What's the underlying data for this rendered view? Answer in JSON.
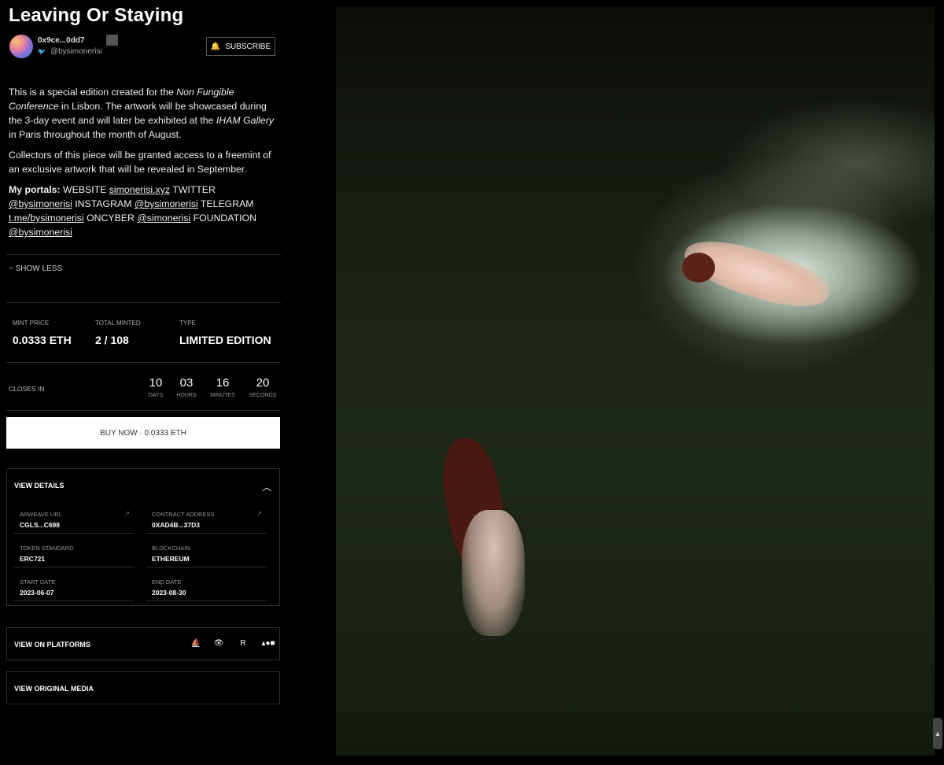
{
  "title": "Leaving Or Staying",
  "creator": {
    "address": "0x9ce...0dd7",
    "address_tag": "·",
    "handle": "@bysimonerisi"
  },
  "subscribe_label": "SUBSCRIBE",
  "description": {
    "p1_a": "This is a special edition created for the ",
    "p1_em1": "Non Fungible Conference",
    "p1_b": " in Lisbon. The artwork will be showcased during the 3-day event and will later be exhibited at the ",
    "p1_em2": "IHAM Gallery",
    "p1_c": " in Paris throughout the month of August.",
    "p2": "Collectors of this piece will be granted access to a freemint of an exclusive artwork that will be revealed in September.",
    "portals_label": "My portals:",
    "portals": [
      {
        "label": "WEBSITE",
        "link": "simonerisi.xyz"
      },
      {
        "label": "TWITTER",
        "link": "@bysimonerisi"
      },
      {
        "label": "INSTAGRAM",
        "link": "@bysimonerisi"
      },
      {
        "label": "TELEGRAM",
        "link": "t.me/bysimonerisi"
      },
      {
        "label": "ONCYBER",
        "link": "@simonerisi"
      },
      {
        "label": "FOUNDATION",
        "link": "@bysimonerisi"
      }
    ]
  },
  "show_less": "− SHOW LESS",
  "stats": {
    "mint_price_label": "MINT PRICE",
    "mint_price": "0.0333 ETH",
    "total_minted_label": "TOTAL MINTED",
    "total_minted": "2 / 108",
    "type_label": "TYPE",
    "type": "LIMITED EDITION"
  },
  "countdown": {
    "label": "CLOSES IN",
    "days": "10",
    "days_label": "DAYS",
    "hours": "03",
    "hours_label": "HOURS",
    "minutes": "16",
    "minutes_label": "MINUTES",
    "seconds": "20",
    "seconds_label": "SECONDS"
  },
  "buy_label": "BUY NOW · 0.0333 ETH",
  "details": {
    "header": "VIEW DETAILS",
    "arweave_label": "ARWEAVE URL",
    "arweave": "CGLS...C698",
    "contract_label": "CONTRACT ADDRESS",
    "contract": "0XAD4B...37D3",
    "token_label": "TOKEN STANDARD",
    "token": "ERC721",
    "chain_label": "BLOCKCHAIN",
    "chain": "ETHEREUM",
    "start_label": "START DATE",
    "start": "2023-06-07",
    "end_label": "END DATE",
    "end": "2023-08-30"
  },
  "platforms_header": "VIEW ON PLATFORMS",
  "original_header": "VIEW ORIGINAL MEDIA",
  "icons": {
    "bell": "bell-icon",
    "twitter": "twitter-icon",
    "external": "external-link-icon",
    "chevron": "chevron-up-icon",
    "platforms": [
      "opensea-icon",
      "looksrare-icon",
      "rarible-icon",
      "blur-icon"
    ]
  }
}
